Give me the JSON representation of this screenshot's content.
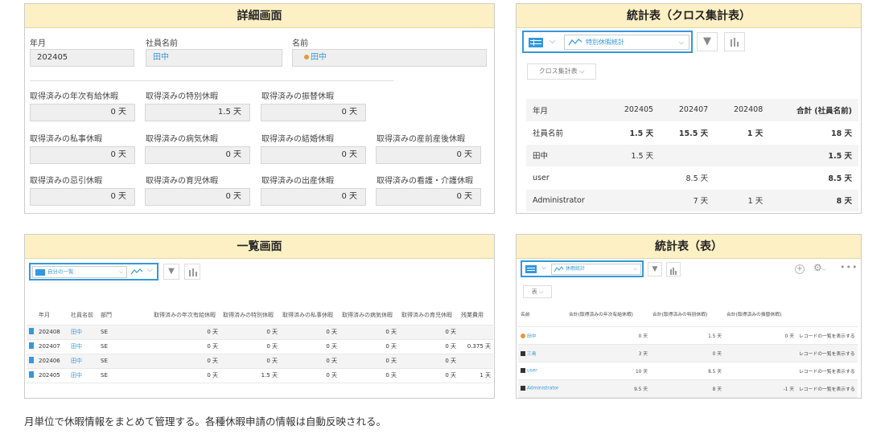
{
  "detail": {
    "title": "詳細画面",
    "top_fields": [
      {
        "label": "年月",
        "value": "202405"
      },
      {
        "label": "社員名前",
        "value": "田中"
      },
      {
        "label": "名前",
        "value": "田中"
      }
    ],
    "rows": [
      [
        {
          "label": "取得済みの年次有給休暇",
          "value": "0 天"
        },
        {
          "label": "取得済みの特別休暇",
          "value": "1.5 天"
        },
        {
          "label": "取得済みの振替休暇",
          "value": "0 天"
        }
      ],
      [
        {
          "label": "取得済みの私事休暇",
          "value": "0 天"
        },
        {
          "label": "取得済みの病気休暇",
          "value": "0 天"
        },
        {
          "label": "取得済みの結婚休暇",
          "value": "0 天"
        },
        {
          "label": "取得済みの産前産後休暇",
          "value": "0 天"
        }
      ],
      [
        {
          "label": "取得済みの忌引休暇",
          "value": "0 天"
        },
        {
          "label": "取得済みの育児休暇",
          "value": "0 天"
        },
        {
          "label": "取得済みの出産休暇",
          "value": "0 天"
        },
        {
          "label": "取得済みの看護・介護休暇",
          "value": "0 天"
        }
      ]
    ]
  },
  "cross": {
    "title": "統計表（クロス集計表）",
    "chart_select": "特別休暇統計",
    "mode_button": "クロス集計表",
    "headers": [
      "年月",
      "202405",
      "202407",
      "202408",
      "合計 (社員名前)"
    ],
    "rows": [
      {
        "cells": [
          "社員名前",
          "1.5 天",
          "15.5 天",
          "1 天",
          "18 天"
        ],
        "total_row": true
      },
      {
        "cells": [
          "田中",
          "1.5 天",
          "",
          "",
          "1.5 天"
        ],
        "total_row": false
      },
      {
        "cells": [
          "user",
          "",
          "8.5 天",
          "",
          "8.5 天"
        ],
        "total_row": false
      },
      {
        "cells": [
          "Administrator",
          "",
          "7 天",
          "1 天",
          "8 天"
        ],
        "total_row": false
      }
    ]
  },
  "list": {
    "title": "一覧画面",
    "view_select": "自分の一覧",
    "headers": [
      "年月",
      "社員名前",
      "部門",
      "取得済みの年次有給休暇",
      "取得済みの特別休暇",
      "取得済みの私事休暇",
      "取得済みの病気休暇",
      "取得済みの育児休暇",
      "残業費用"
    ],
    "rows": [
      [
        "202408",
        "田中",
        "SE",
        "0 天",
        "0 天",
        "0 天",
        "0 天",
        "0 天",
        ""
      ],
      [
        "202407",
        "田中",
        "SE",
        "0 天",
        "0 天",
        "0 天",
        "0 天",
        "0 天",
        "0.375 天"
      ],
      [
        "202406",
        "田中",
        "SE",
        "0 天",
        "0 天",
        "0 天",
        "0 天",
        "0 天",
        ""
      ],
      [
        "202405",
        "田中",
        "SE",
        "0 天",
        "1.5 天",
        "0 天",
        "0 天",
        "0 天",
        "1 天"
      ]
    ]
  },
  "stats": {
    "title": "統計表（表）",
    "chart_select": "休暇統計",
    "mode_button": "表",
    "headers": [
      "名前",
      "合計(取得済みの年次有給休暇)",
      "合計(取得済みの特別休暇)",
      "合計(取得済みの振替休暇)",
      ""
    ],
    "link_label": "レコードの一覧を表示する",
    "rows": [
      {
        "name": "田中",
        "icon": "user-orange",
        "v": [
          "0 天",
          "1.5 天",
          "0 天"
        ]
      },
      {
        "name": "三島",
        "icon": "user-dark",
        "v": [
          "3 天",
          "0 天",
          ""
        ]
      },
      {
        "name": "user",
        "icon": "user-dark",
        "v": [
          "10 天",
          "8.5 天",
          ""
        ]
      },
      {
        "name": "Administrator",
        "icon": "user-dark",
        "v": [
          "9.5 天",
          "8 天",
          "-1 天"
        ]
      }
    ]
  },
  "caption": "月単位で休暇情報をまとめて管理する。各種休暇申請の情報は自動反映される。",
  "colors": {
    "title_bg": "#fdf0c4",
    "accent": "#3498db"
  }
}
